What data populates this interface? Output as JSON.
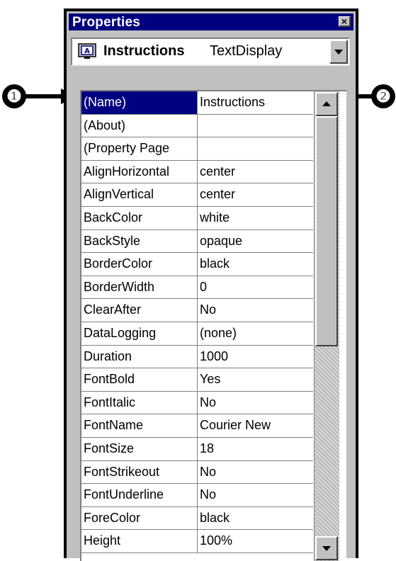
{
  "window": {
    "title": "Properties",
    "close_label": "×"
  },
  "object_selector": {
    "icon": "text-display-icon",
    "name": "Instructions",
    "type": "TextDisplay"
  },
  "callouts": {
    "left": "❶",
    "right": "❷"
  },
  "properties": [
    {
      "name": "(Name)",
      "value": "Instructions",
      "selected": true
    },
    {
      "name": "(About)",
      "value": ""
    },
    {
      "name": "(Property Page",
      "value": ""
    },
    {
      "name": "AlignHorizontal",
      "value": "center"
    },
    {
      "name": "AlignVertical",
      "value": "center"
    },
    {
      "name": "BackColor",
      "value": "white"
    },
    {
      "name": "BackStyle",
      "value": "opaque"
    },
    {
      "name": "BorderColor",
      "value": "black"
    },
    {
      "name": "BorderWidth",
      "value": "0"
    },
    {
      "name": "ClearAfter",
      "value": "No"
    },
    {
      "name": "DataLogging",
      "value": "(none)"
    },
    {
      "name": "Duration",
      "value": "1000"
    },
    {
      "name": "FontBold",
      "value": "Yes"
    },
    {
      "name": "FontItalic",
      "value": "No"
    },
    {
      "name": "FontName",
      "value": "Courier New"
    },
    {
      "name": "FontSize",
      "value": "18"
    },
    {
      "name": "FontStrikeout",
      "value": "No"
    },
    {
      "name": "FontUnderline",
      "value": "No"
    },
    {
      "name": "ForeColor",
      "value": "black"
    },
    {
      "name": "Height",
      "value": "100%"
    }
  ],
  "colors": {
    "titlebar": "#000080",
    "selection": "#000080",
    "face": "#c0c0c0"
  }
}
